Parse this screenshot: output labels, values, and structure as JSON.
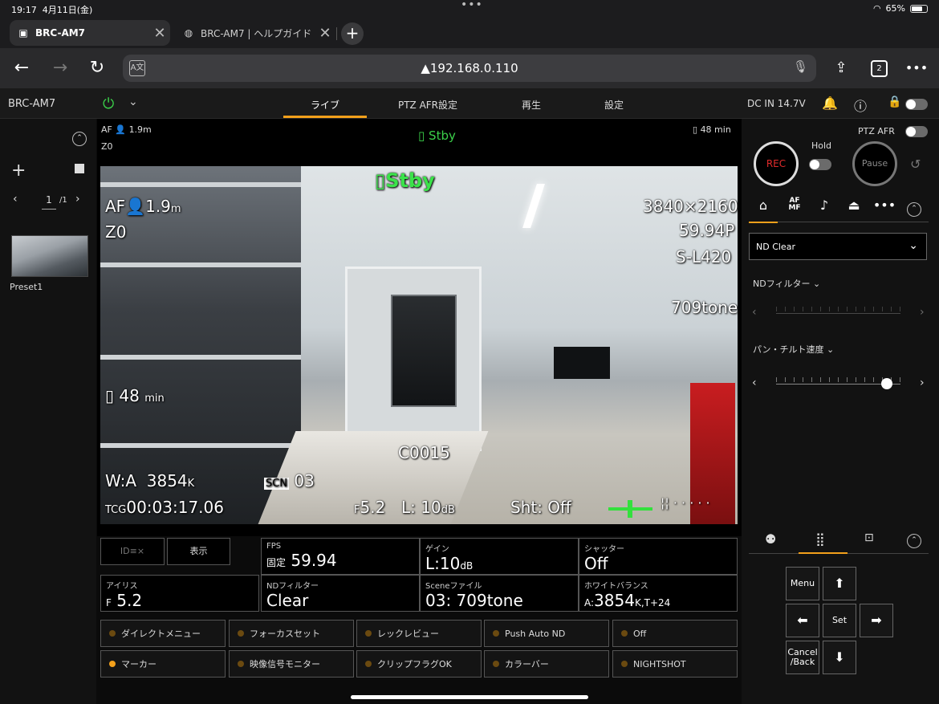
{
  "status_bar": {
    "time": "19:17",
    "date": "4月11日(金)",
    "battery": "65%",
    "battery_level": 0.65
  },
  "browser": {
    "tabs": [
      {
        "label": "BRC-AM7",
        "active": true
      },
      {
        "label": "BRC-AM7 | ヘルプガイド",
        "active": false
      }
    ],
    "address": "192.168.0.110",
    "tab_count": "2",
    "translate_label": "A文"
  },
  "app_header": {
    "device_name": "BRC-AM7",
    "tabs": [
      "ライブ",
      "PTZ AFR設定",
      "再生",
      "設定"
    ],
    "active_tab": "ライブ",
    "power_input": "DC IN 14.7V",
    "accent": "#f3a01b",
    "power_color": "#3bd14a"
  },
  "left_panel": {
    "page_current": "1",
    "page_total": "/1",
    "preset_label": "Preset1"
  },
  "monitor": {
    "top_af": "AF",
    "top_distance": "1.9m",
    "top_zoom": "Z0",
    "top_status": "Stby",
    "top_battery": "48 min",
    "overlay": {
      "stby": "Stby",
      "af": "AF",
      "distance": "1.9",
      "distance_unit": "m",
      "zoom": "Z0",
      "resolution": "3840×2160",
      "framerate": "59.94P",
      "log": "S-L420",
      "look": "709tone",
      "battery": "48",
      "battery_unit": "min",
      "clip": "C0015",
      "wb": "W:A",
      "wb_value": "3854",
      "wb_unit": "K",
      "scn_label": "SCN",
      "scn_value": "03",
      "tcg_label": "TCG",
      "timecode": "00:03:17.06",
      "iris_prefix": "F",
      "iris": "5.2",
      "gain_prefix": "L:",
      "gain": "10",
      "gain_unit": "dB",
      "shutter": "Sht: Off"
    }
  },
  "info_grid": {
    "overlay_toggle_label": "ID≡×",
    "display_button": "表示",
    "cells": [
      {
        "label": "FPS",
        "prefix": "固定",
        "value": "59.94",
        "suffix": ""
      },
      {
        "label": "ゲイン",
        "prefix": "",
        "value": "L:10",
        "suffix": "dB"
      },
      {
        "label": "シャッター",
        "prefix": "",
        "value": "Off",
        "suffix": ""
      },
      {
        "label": "アイリス",
        "prefix": "F",
        "value": "5.2",
        "suffix": ""
      },
      {
        "label": "NDフィルター",
        "prefix": "",
        "value": "Clear",
        "suffix": ""
      },
      {
        "label": "Sceneファイル",
        "prefix": "",
        "value": "03: 709tone",
        "suffix": ""
      },
      {
        "label": "ホワイトバランス",
        "prefix": "A:",
        "value": "3854",
        "suffix": "K,T+24"
      }
    ]
  },
  "assign_buttons": [
    {
      "label": "ダイレクトメニュー",
      "on": false
    },
    {
      "label": "フォーカスセット",
      "on": false
    },
    {
      "label": "レックレビュー",
      "on": false
    },
    {
      "label": "Push Auto ND",
      "on": false
    },
    {
      "label": "Off",
      "on": false
    },
    {
      "label": "マーカー",
      "on": true
    },
    {
      "label": "映像信号モニター",
      "on": false
    },
    {
      "label": "クリップフラグOK",
      "on": false
    },
    {
      "label": "カラーバー",
      "on": false
    },
    {
      "label": "NIGHTSHOT",
      "on": false
    }
  ],
  "right_panel": {
    "rec_label": "REC",
    "hold_label": "Hold",
    "ptz_afr_label": "PTZ AFR",
    "pause_label": "Pause",
    "tabs": [
      "home-icon",
      "af-mf-icon",
      "music-note-icon",
      "scene-icon",
      "more-icon"
    ],
    "af_mf_top": "AF",
    "af_mf_bottom": "MF",
    "nd_dropdown": "ND Clear",
    "nd_filter_label": "NDフィルター",
    "pan_tilt_label": "パン・チルト速度",
    "pan_tilt_level": 0.88,
    "dpad": {
      "menu": "Menu",
      "set": "Set",
      "cancel": "Cancel /Back"
    }
  }
}
